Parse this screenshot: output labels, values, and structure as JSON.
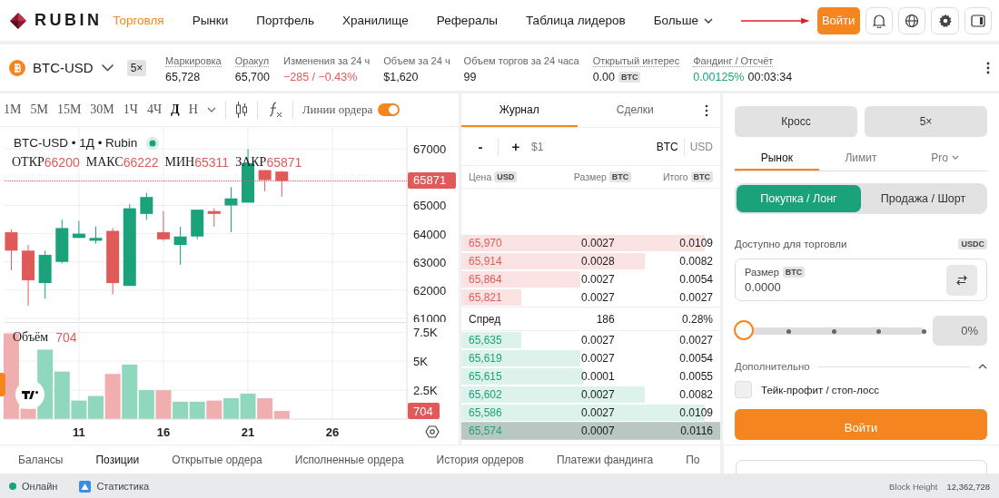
{
  "header": {
    "logo": "RUBIN",
    "nav": [
      {
        "label": "Торговля",
        "selected": true,
        "kind": "link"
      },
      {
        "label": "Рынки",
        "selected": false,
        "kind": "link"
      },
      {
        "label": "Портфель",
        "selected": false,
        "kind": "link"
      },
      {
        "label": "Хранилище",
        "selected": false,
        "kind": "link"
      },
      {
        "label": "Рефералы",
        "selected": false,
        "kind": "link"
      },
      {
        "label": "Таблица лидеров",
        "selected": false,
        "kind": "link"
      },
      {
        "label": "Больше",
        "selected": false,
        "kind": "dropdown"
      }
    ],
    "login_button": "Войти"
  },
  "market_bar": {
    "symbol": "BTC-USD",
    "leverage": "5×",
    "stats": [
      {
        "label": "Маркировка",
        "value": "65,728",
        "dotted": true,
        "kind": "plain"
      },
      {
        "label": "Оракул",
        "value": "65,700",
        "dotted": true,
        "kind": "plain"
      },
      {
        "label": "Изменения за 24 ч",
        "value": "−285 / −0.43%",
        "dotted": false,
        "kind": "negative"
      },
      {
        "label": "Объем за 24 ч",
        "value": "$1,620",
        "dotted": false,
        "kind": "plain"
      },
      {
        "label": "Объем торгов за 24 часа",
        "value": "99",
        "dotted": false,
        "kind": "plain"
      },
      {
        "label": "Открытый интерес",
        "value": "0.00",
        "unit": "BTC",
        "dotted": true,
        "kind": "unit"
      },
      {
        "label": "Фандинг / Отсчёт",
        "value": "0.00125%",
        "extra": "00:03:34",
        "dotted": true,
        "kind": "positive"
      }
    ]
  },
  "chart": {
    "timeframes": [
      {
        "label": "1М",
        "selected": false
      },
      {
        "label": "5М",
        "selected": false
      },
      {
        "label": "15М",
        "selected": false
      },
      {
        "label": "30М",
        "selected": false
      },
      {
        "label": "1Ч",
        "selected": false
      },
      {
        "label": "4Ч",
        "selected": false
      },
      {
        "label": "Д",
        "selected": true
      },
      {
        "label": "Н",
        "selected": false
      }
    ],
    "order_lines": {
      "label": "Линии ордера",
      "on": true
    },
    "legend": {
      "title": "BTC-USD • 1Д • Rubin",
      "ohlc": [
        {
          "label": "ОТКР",
          "value": "66200"
        },
        {
          "label": "МАКС",
          "value": "66222"
        },
        {
          "label": "МИН",
          "value": "65311"
        },
        {
          "label": "ЗАКР",
          "value": "65871"
        }
      ]
    },
    "price": {
      "chart_data": {
        "type": "candlestick",
        "x": [
          7,
          8,
          9,
          10,
          11,
          12,
          13,
          14,
          15,
          16,
          17,
          18,
          19,
          20,
          21,
          22,
          23
        ],
        "ohlc": [
          [
            64050,
            64150,
            62700,
            63400
          ],
          [
            63400,
            63600,
            61450,
            62350
          ],
          [
            62250,
            63400,
            61700,
            63250
          ],
          [
            63000,
            64500,
            62950,
            64200
          ],
          [
            63850,
            64450,
            63850,
            64000
          ],
          [
            63750,
            64250,
            63650,
            63850
          ],
          [
            64100,
            64200,
            61850,
            62250
          ],
          [
            62150,
            65050,
            62150,
            64900
          ],
          [
            64700,
            65450,
            64500,
            65300
          ],
          [
            64050,
            64800,
            63750,
            63800
          ],
          [
            63600,
            64250,
            62900,
            63900
          ],
          [
            63900,
            64850,
            63800,
            64850
          ],
          [
            64800,
            64900,
            64250,
            64700
          ],
          [
            65000,
            65650,
            64050,
            65250
          ],
          [
            65100,
            67000,
            65100,
            66500
          ],
          [
            66250,
            66250,
            65500,
            65900
          ],
          [
            66200,
            66222,
            65311,
            65871
          ]
        ],
        "xlim": [
          6.6,
          30.4
        ],
        "ylim": [
          60870,
          67780
        ],
        "grid": true,
        "yticks": [
          61000,
          62000,
          63000,
          64000,
          65000,
          67000
        ]
      }
    },
    "price_tag": "65871",
    "volume_legend": {
      "label": "Объём",
      "value": "704"
    },
    "volume_tag": "704",
    "volume": {
      "chart_data": {
        "type": "bar",
        "x": [
          7,
          8,
          9,
          10,
          11,
          12,
          13,
          14,
          15,
          16,
          17,
          18,
          19,
          20,
          21,
          22,
          23
        ],
        "values": [
          7400,
          900,
          6000,
          4100,
          1600,
          2000,
          3900,
          4700,
          2500,
          2500,
          1500,
          1500,
          1600,
          1800,
          2200,
          1800,
          700
        ],
        "xlim": [
          6.6,
          30.4
        ],
        "ylim": [
          0,
          8380
        ],
        "grid": true,
        "xticks": [
          {
            "value": 11,
            "label": "11"
          },
          {
            "value": 16,
            "label": "16"
          },
          {
            "value": 21,
            "label": "21"
          },
          {
            "value": 26,
            "label": "26"
          }
        ],
        "yticks": [
          {
            "value": 2500,
            "label": "2.5K"
          },
          {
            "value": 5000,
            "label": "5K"
          },
          {
            "value": 7500,
            "label": "7.5K"
          }
        ]
      }
    }
  },
  "orderbook": {
    "tabs": [
      {
        "label": "Журнал",
        "selected": true
      },
      {
        "label": "Сделки",
        "selected": false
      }
    ],
    "minus": "-",
    "plus": "+",
    "step": "$1",
    "units": [
      {
        "label": "BTC",
        "selected": true
      },
      {
        "label": "USD",
        "selected": false
      }
    ],
    "columns": [
      {
        "label": "Цена",
        "unit": "USD"
      },
      {
        "label": "Размер",
        "unit": "BTC"
      },
      {
        "label": "Итого",
        "unit": "BTC"
      }
    ],
    "asks": [
      {
        "price": "65,970",
        "size": "0.0027",
        "total": "0.0109",
        "level": 0.94
      },
      {
        "price": "65,914",
        "size": "0.0028",
        "total": "0.0082",
        "level": 0.71
      },
      {
        "price": "65,864",
        "size": "0.0027",
        "total": "0.0054",
        "level": 0.46
      },
      {
        "price": "65,821",
        "size": "0.0027",
        "total": "0.0027",
        "level": 0.23
      }
    ],
    "spread": {
      "label": "Спред",
      "value": "186",
      "percent": "0.28%"
    },
    "bids": [
      {
        "price": "65,635",
        "size": "0.0027",
        "total": "0.0027",
        "level": 0.23,
        "highlighted": false
      },
      {
        "price": "65,619",
        "size": "0.0027",
        "total": "0.0054",
        "level": 0.46,
        "highlighted": false
      },
      {
        "price": "65,615",
        "size": "0.0001",
        "total": "0.0055",
        "level": 0.47,
        "highlighted": false
      },
      {
        "price": "65,602",
        "size": "0.0027",
        "total": "0.0082",
        "level": 0.71,
        "highlighted": false
      },
      {
        "price": "65,586",
        "size": "0.0027",
        "total": "0.0109",
        "level": 0.94,
        "highlighted": false
      },
      {
        "price": "65,574",
        "size": "0.0007",
        "total": "0.0116",
        "level": 1,
        "highlighted": true
      }
    ]
  },
  "trade": {
    "margin_buttons": [
      "Кросс",
      "5×"
    ],
    "order_tabs": [
      {
        "label": "Рынок",
        "selected": true,
        "kind": "plain"
      },
      {
        "label": "Лимит",
        "selected": false,
        "kind": "plain"
      },
      {
        "label": "Pro",
        "selected": false,
        "kind": "dropdown"
      }
    ],
    "sides": [
      {
        "label": "Покупка / Лонг",
        "selected": true
      },
      {
        "label": "Продажа / Шорт",
        "selected": false
      }
    ],
    "available": {
      "label": "Доступно для торговли",
      "unit": "USDC"
    },
    "size": {
      "label": "Размер",
      "unit": "BTC",
      "value": "0.0000"
    },
    "slider": {
      "level": 0,
      "reading": "0%"
    },
    "advanced": {
      "label": "Дополнительно",
      "expanded": true
    },
    "tpsl": {
      "label": "Тейк-профит / стоп-лосс",
      "checked": false
    },
    "submit": "Войти"
  },
  "bottom_tabs": [
    {
      "label": "Балансы",
      "selected": false
    },
    {
      "label": "Позиции",
      "selected": true
    },
    {
      "label": "Открытые ордера",
      "selected": false
    },
    {
      "label": "Исполненные ордера",
      "selected": false
    },
    {
      "label": "История ордеров",
      "selected": false
    },
    {
      "label": "Платежи фандинга",
      "selected": false
    },
    {
      "label": "По",
      "selected": false
    }
  ],
  "status_bar": {
    "online": "Онлайн",
    "stats": "Статистика",
    "block_label": "Block Height",
    "block_value": "12,362,728"
  }
}
